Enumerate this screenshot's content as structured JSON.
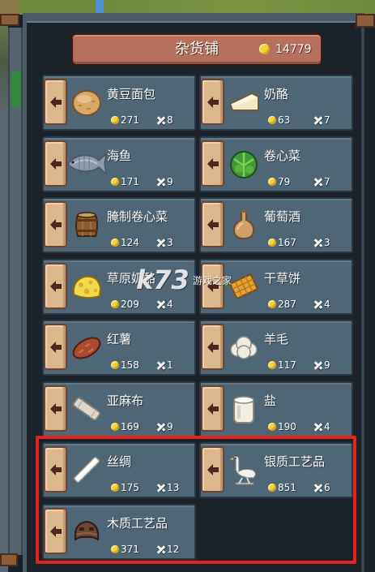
{
  "store": {
    "title": "杂货铺",
    "coins": "14779"
  },
  "items": [
    {
      "name": "黄豆面包",
      "price": "271",
      "count": "8",
      "icon": "bread-icon"
    },
    {
      "name": "奶酪",
      "price": "63",
      "count": "7",
      "icon": "cheese-icon"
    },
    {
      "name": "海鱼",
      "price": "171",
      "count": "9",
      "icon": "fish-icon"
    },
    {
      "name": "卷心菜",
      "price": "79",
      "count": "7",
      "icon": "cabbage-icon"
    },
    {
      "name": "腌制卷心菜",
      "price": "124",
      "count": "3",
      "icon": "barrel-icon"
    },
    {
      "name": "葡萄酒",
      "price": "167",
      "count": "3",
      "icon": "wine-bottle-icon"
    },
    {
      "name": "草原奶酪",
      "price": "209",
      "count": "4",
      "icon": "cheese-wheel-icon"
    },
    {
      "name": "干草饼",
      "price": "287",
      "count": "4",
      "icon": "hay-cake-icon"
    },
    {
      "name": "红薯",
      "price": "158",
      "count": "1",
      "icon": "sweet-potato-icon"
    },
    {
      "name": "羊毛",
      "price": "117",
      "count": "9",
      "icon": "wool-icon"
    },
    {
      "name": "亚麻布",
      "price": "169",
      "count": "9",
      "icon": "linen-roll-icon"
    },
    {
      "name": "盐",
      "price": "190",
      "count": "4",
      "icon": "salt-jar-icon"
    },
    {
      "name": "丝绸",
      "price": "175",
      "count": "13",
      "icon": "silk-roll-icon"
    },
    {
      "name": "银质工艺品",
      "price": "851",
      "count": "6",
      "icon": "silver-crane-icon"
    },
    {
      "name": "木质工艺品",
      "price": "371",
      "count": "12",
      "icon": "wooden-mask-icon"
    }
  ],
  "icons": {
    "currency": "coin-icon",
    "quantity": "quantity-x-icon",
    "transfer": "left-arrow-icon"
  },
  "watermark": {
    "logo": "k73",
    "text": "游戏之家"
  },
  "colors": {
    "panel_bg": "#1c222a",
    "card_bg": "#4f6677",
    "header_bg": "#b5715e",
    "arrow_tab": "#dcb68c",
    "coin": "#f6d33c",
    "highlight": "#e3241b"
  }
}
